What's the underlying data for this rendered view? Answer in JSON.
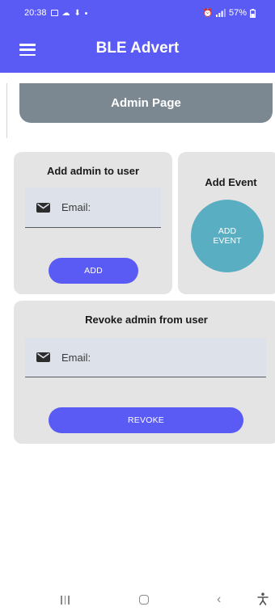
{
  "status_bar": {
    "time": "20:38",
    "battery": "57%"
  },
  "app_bar": {
    "title": "BLE Advert",
    "menu_icon": "hamburger-menu-icon"
  },
  "page_header": {
    "title": "Admin Page"
  },
  "add_admin_card": {
    "title": "Add admin to user",
    "email_placeholder": "Email:",
    "email_icon": "mail-icon",
    "button_label": "ADD"
  },
  "add_event_card": {
    "title": "Add Event",
    "button_line1": "ADD",
    "button_line2": "EVENT"
  },
  "revoke_admin_card": {
    "title": "Revoke admin from user",
    "email_placeholder": "Email:",
    "email_icon": "mail-icon",
    "button_label": "REVOKE"
  },
  "nav_bar": {
    "recents_icon": "recents-icon",
    "home_icon": "home-icon",
    "back_icon": "back-icon",
    "accessibility_icon": "accessibility-icon"
  },
  "colors": {
    "primary": "#5a5af5",
    "header_gray": "#7b8791",
    "card_background": "#e4e4e4",
    "field_background": "#dde2ea",
    "event_circle": "#5aaec2"
  }
}
